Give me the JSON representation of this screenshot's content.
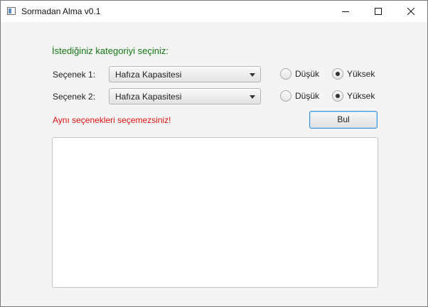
{
  "window": {
    "title": "Sormadan Alma v0.1",
    "icon": "app-window-icon",
    "controls": [
      "minimize-icon",
      "maximize-icon",
      "close-icon"
    ]
  },
  "form": {
    "heading": "İstediğiniz kategoriyi seçiniz:",
    "option1": {
      "label": "Seçenek 1:",
      "selected": "Hafıza Kapasitesi",
      "radios": [
        {
          "label": "Düşük",
          "checked": false
        },
        {
          "label": "Yüksek",
          "checked": true
        }
      ]
    },
    "option2": {
      "label": "Seçenek 2:",
      "selected": "Hafıza Kapasitesi",
      "radios": [
        {
          "label": "Düşük",
          "checked": false
        },
        {
          "label": "Yüksek",
          "checked": true
        }
      ]
    },
    "error_message": "Aynı seçenekleri seçemezsiniz!",
    "button_label": "Bul",
    "output_text": ""
  },
  "colors": {
    "heading": "#117711",
    "error": "#e01010",
    "button_focus_border": "#3c8ed6"
  }
}
